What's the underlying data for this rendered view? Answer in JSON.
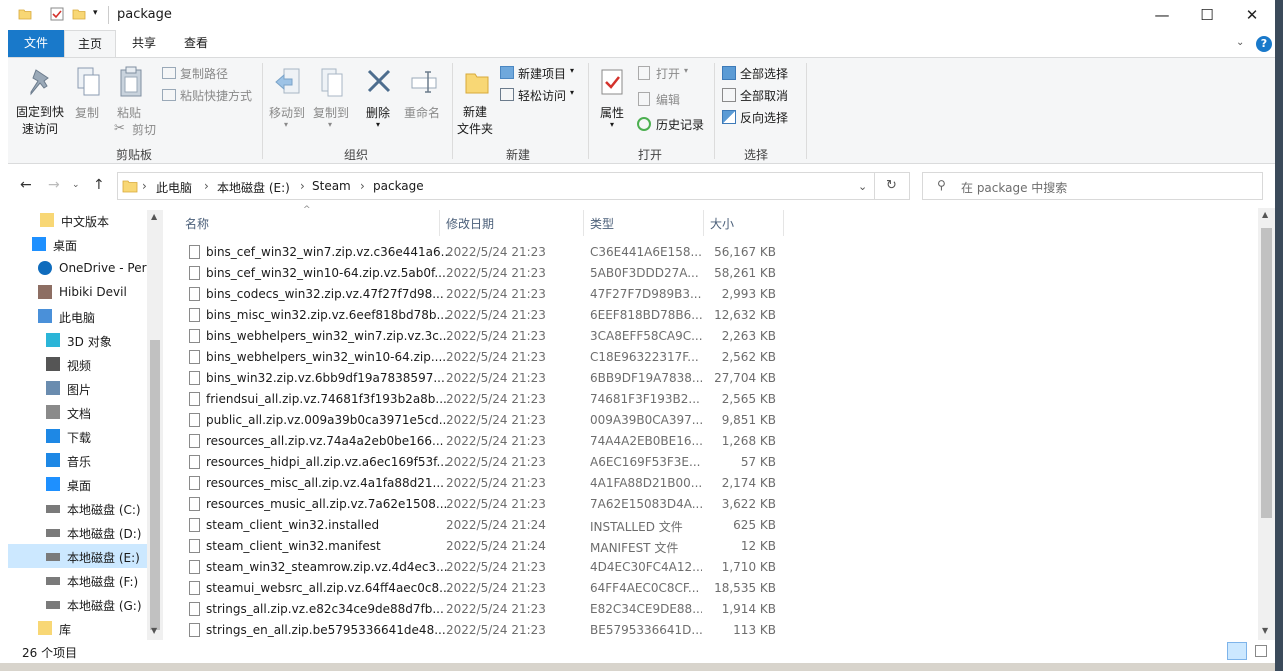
{
  "titlebar": {
    "title": "package",
    "minimize": "—",
    "maximize": "☐",
    "close": "✕"
  },
  "tabs": {
    "file": "文件",
    "home": "主页",
    "share": "共享",
    "view": "查看"
  },
  "ribbon": {
    "clipboard": {
      "pin": "固定到快\n速访问",
      "copy": "复制",
      "paste": "粘贴",
      "copy_path": "复制路径",
      "paste_shortcut": "粘贴快捷方式",
      "cut": "剪切",
      "group": "剪贴板"
    },
    "organize": {
      "move_to": "移动到",
      "copy_to": "复制到",
      "delete": "删除",
      "rename": "重命名",
      "group": "组织"
    },
    "new": {
      "new_folder": "新建\n文件夹",
      "new_item": "新建项目",
      "easy_access": "轻松访问",
      "group": "新建"
    },
    "open": {
      "properties": "属性",
      "open": "打开",
      "edit": "编辑",
      "history": "历史记录",
      "group": "打开"
    },
    "select": {
      "select_all": "全部选择",
      "select_none": "全部取消",
      "invert": "反向选择",
      "group": "选择"
    }
  },
  "address": {
    "crumbs": [
      "此电脑",
      "本地磁盘 (E:)",
      "Steam",
      "package"
    ]
  },
  "search": {
    "placeholder": "在 package 中搜索"
  },
  "nav": [
    {
      "label": "中文版本",
      "icon": "folder-icon"
    },
    {
      "label": "桌面",
      "icon": "desktop-icon"
    },
    {
      "label": "OneDrive - Per",
      "icon": "onedrive-icon"
    },
    {
      "label": "Hibiki Devil",
      "icon": "user-icon"
    },
    {
      "label": "此电脑",
      "icon": "computer-icon"
    },
    {
      "label": "3D 对象",
      "icon": "3d-objects-icon"
    },
    {
      "label": "视频",
      "icon": "video-icon"
    },
    {
      "label": "图片",
      "icon": "pictures-icon"
    },
    {
      "label": "文档",
      "icon": "documents-icon"
    },
    {
      "label": "下载",
      "icon": "downloads-icon"
    },
    {
      "label": "音乐",
      "icon": "music-icon"
    },
    {
      "label": "桌面",
      "icon": "desktop-icon"
    },
    {
      "label": "本地磁盘 (C:)",
      "icon": "drive-icon"
    },
    {
      "label": "本地磁盘 (D:)",
      "icon": "drive-icon"
    },
    {
      "label": "本地磁盘 (E:)",
      "icon": "drive-icon"
    },
    {
      "label": "本地磁盘 (F:)",
      "icon": "drive-icon"
    },
    {
      "label": "本地磁盘 (G:)",
      "icon": "drive-icon"
    },
    {
      "label": "库",
      "icon": "library-icon"
    }
  ],
  "columns": {
    "name": "名称",
    "date": "修改日期",
    "type": "类型",
    "size": "大小"
  },
  "files": [
    {
      "name": "bins_cef_win32_win7.zip.vz.c36e441a6...",
      "date": "2022/5/24 21:23",
      "type": "C36E441A6E158...",
      "size": "56,167 KB"
    },
    {
      "name": "bins_cef_win32_win10-64.zip.vz.5ab0f...",
      "date": "2022/5/24 21:23",
      "type": "5AB0F3DDD27A...",
      "size": "58,261 KB"
    },
    {
      "name": "bins_codecs_win32.zip.vz.47f27f7d98...",
      "date": "2022/5/24 21:23",
      "type": "47F27F7D989B3...",
      "size": "2,993 KB"
    },
    {
      "name": "bins_misc_win32.zip.vz.6eef818bd78b...",
      "date": "2022/5/24 21:23",
      "type": "6EEF818BD78B6...",
      "size": "12,632 KB"
    },
    {
      "name": "bins_webhelpers_win32_win7.zip.vz.3c...",
      "date": "2022/5/24 21:23",
      "type": "3CA8EFF58CA9C...",
      "size": "2,263 KB"
    },
    {
      "name": "bins_webhelpers_win32_win10-64.zip....",
      "date": "2022/5/24 21:23",
      "type": "C18E96322317F...",
      "size": "2,562 KB"
    },
    {
      "name": "bins_win32.zip.vz.6bb9df19a7838597...",
      "date": "2022/5/24 21:23",
      "type": "6BB9DF19A7838...",
      "size": "27,704 KB"
    },
    {
      "name": "friendsui_all.zip.vz.74681f3f193b2a8b...",
      "date": "2022/5/24 21:23",
      "type": "74681F3F193B2...",
      "size": "2,565 KB"
    },
    {
      "name": "public_all.zip.vz.009a39b0ca3971e5cd...",
      "date": "2022/5/24 21:23",
      "type": "009A39B0CA397...",
      "size": "9,851 KB"
    },
    {
      "name": "resources_all.zip.vz.74a4a2eb0be166...",
      "date": "2022/5/24 21:23",
      "type": "74A4A2EB0BE16...",
      "size": "1,268 KB"
    },
    {
      "name": "resources_hidpi_all.zip.vz.a6ec169f53f...",
      "date": "2022/5/24 21:23",
      "type": "A6EC169F53F3E...",
      "size": "57 KB"
    },
    {
      "name": "resources_misc_all.zip.vz.4a1fa88d21...",
      "date": "2022/5/24 21:23",
      "type": "4A1FA88D21B00...",
      "size": "2,174 KB"
    },
    {
      "name": "resources_music_all.zip.vz.7a62e1508...",
      "date": "2022/5/24 21:23",
      "type": "7A62E15083D4A...",
      "size": "3,622 KB"
    },
    {
      "name": "steam_client_win32.installed",
      "date": "2022/5/24 21:24",
      "type": "INSTALLED 文件",
      "size": "625 KB"
    },
    {
      "name": "steam_client_win32.manifest",
      "date": "2022/5/24 21:24",
      "type": "MANIFEST 文件",
      "size": "12 KB"
    },
    {
      "name": "steam_win32_steamrow.zip.vz.4d4ec3...",
      "date": "2022/5/24 21:23",
      "type": "4D4EC30FC4A12...",
      "size": "1,710 KB"
    },
    {
      "name": "steamui_websrc_all.zip.vz.64ff4aec0c8...",
      "date": "2022/5/24 21:23",
      "type": "64FF4AEC0C8CF...",
      "size": "18,535 KB"
    },
    {
      "name": "strings_all.zip.vz.e82c34ce9de88d7fb...",
      "date": "2022/5/24 21:23",
      "type": "E82C34CE9DE88...",
      "size": "1,914 KB"
    },
    {
      "name": "strings_en_all.zip.be5795336641de48...",
      "date": "2022/5/24 21:23",
      "type": "BE5795336641D...",
      "size": "113 KB"
    }
  ],
  "status": {
    "count": "26 个项目"
  },
  "colors": {
    "accent": "#1979ca",
    "selected": "#cce8ff",
    "folder": "#f8d775"
  }
}
